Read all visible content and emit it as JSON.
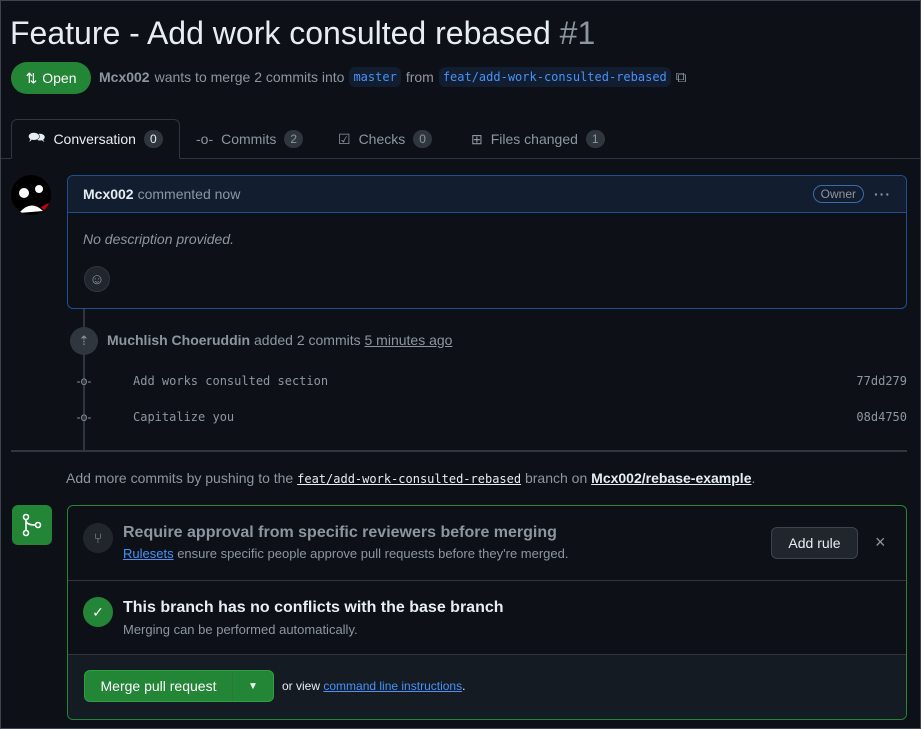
{
  "pr": {
    "title": "Feature - Add work consulted rebased",
    "number": "#1",
    "state": "Open",
    "author": "Mcx002",
    "summary": "wants to merge 2 commits into",
    "base": "master",
    "from": "from",
    "head": "feat/add-work-consulted-rebased"
  },
  "tabs": [
    {
      "label": "Conversation",
      "count": "0"
    },
    {
      "label": "Commits",
      "count": "2"
    },
    {
      "label": "Checks",
      "count": "0"
    },
    {
      "label": "Files changed",
      "count": "1"
    }
  ],
  "comment": {
    "author": "Mcx002",
    "action": "commented now",
    "badge": "Owner",
    "more": "···",
    "body": "No description provided."
  },
  "push": {
    "author": "Muchlish Choeruddin",
    "action": "added 2 commits",
    "time": "5 minutes ago"
  },
  "commits": [
    {
      "message": "Add works consulted section",
      "sha": "77dd279"
    },
    {
      "message": "Capitalize you",
      "sha": "08d4750"
    }
  ],
  "addmore": {
    "prefix": "Add more commits by pushing to the",
    "branch": "feat/add-work-consulted-rebased",
    "mid": "branch on",
    "repo": "Mcx002/rebase-example",
    "suffix": "."
  },
  "merge": {
    "rule_title": "Require approval from specific reviewers before merging",
    "rule_link": "Rulesets",
    "rule_desc": "ensure specific people approve pull requests before they're merged.",
    "add_rule": "Add rule",
    "close": "×",
    "status_title": "This branch has no conflicts with the base branch",
    "status_desc": "Merging can be performed automatically.",
    "button": "Merge pull request",
    "or_view": "or view",
    "cli_link": "command line instructions",
    "cli_suffix": "."
  },
  "colors": {
    "green": "#238636",
    "accent": "#4493f8",
    "bg": "#0d1117"
  }
}
